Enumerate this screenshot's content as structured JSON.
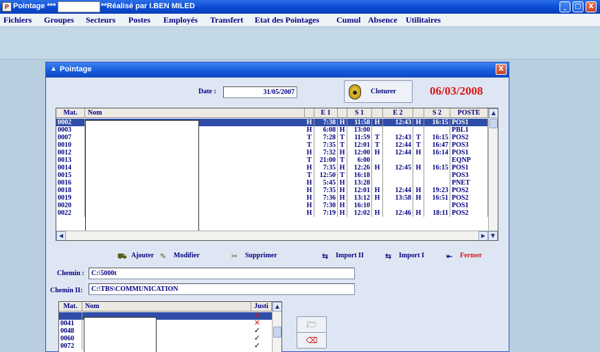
{
  "window": {
    "app_icon": "P",
    "title_left": "Pointage ***",
    "title_right": "**Réalisé par I.BEN MILED",
    "buttons": [
      "_",
      "□",
      "X"
    ]
  },
  "menu": [
    "Fichiers",
    "Groupes",
    "Secteurs",
    "Postes",
    "Employés",
    "Transfert",
    "Etat des Pointages",
    "Cumul",
    "Absence",
    "Utilitaires"
  ],
  "dialog": {
    "title": "Pointage",
    "title_icon": "triangle-icon",
    "close": "X",
    "date_label": "Date :",
    "date_value": "31/05/2007",
    "cloturer_label": "Cloturer",
    "current_date": "06/03/2008"
  },
  "grid": {
    "headers": [
      "Mat.",
      "Nom",
      "",
      "E 1",
      "",
      "S 1",
      "",
      "E 2",
      "",
      "S 2",
      "POSTE"
    ],
    "rows": [
      {
        "mat": "0002",
        "t1": "H",
        "e1": "7:38",
        "t2": "H",
        "s1": "11:58",
        "t3": "H",
        "e2": "12:43",
        "t4": "H",
        "s2": "16:15",
        "poste": "POS1",
        "selected": true
      },
      {
        "mat": "0003",
        "t1": "H",
        "e1": "6:08",
        "t2": "H",
        "s1": "13:00",
        "t3": "",
        "e2": "",
        "t4": "",
        "s2": "",
        "poste": "PBL1"
      },
      {
        "mat": "0007",
        "t1": "T",
        "e1": "7:28",
        "t2": "T",
        "s1": "11:59",
        "t3": "T",
        "e2": "12:43",
        "t4": "T",
        "s2": "16:15",
        "poste": "POS2"
      },
      {
        "mat": "0010",
        "t1": "T",
        "e1": "7:35",
        "t2": "T",
        "s1": "12:01",
        "t3": "T",
        "e2": "12:44",
        "t4": "T",
        "s2": "16:47",
        "poste": "POS3"
      },
      {
        "mat": "0012",
        "t1": "H",
        "e1": "7:32",
        "t2": "H",
        "s1": "12:00",
        "t3": "H",
        "e2": "12:44",
        "t4": "H",
        "s2": "16:14",
        "poste": "POS1"
      },
      {
        "mat": "0013",
        "t1": "T",
        "e1": "21:00",
        "t2": "T",
        "s1": "6:00",
        "t3": "",
        "e2": "",
        "t4": "",
        "s2": "",
        "poste": "EQNP"
      },
      {
        "mat": "0014",
        "t1": "H",
        "e1": "7:35",
        "t2": "H",
        "s1": "12:26",
        "t3": "H",
        "e2": "12:45",
        "t4": "H",
        "s2": "16:15",
        "poste": "POS1"
      },
      {
        "mat": "0015",
        "t1": "T",
        "e1": "12:50",
        "t2": "T",
        "s1": "16:18",
        "t3": "",
        "e2": "",
        "t4": "",
        "s2": "",
        "poste": "POS3"
      },
      {
        "mat": "0016",
        "t1": "H",
        "e1": "5:45",
        "t2": "H",
        "s1": "13:28",
        "t3": "",
        "e2": "",
        "t4": "",
        "s2": "",
        "poste": "PNET"
      },
      {
        "mat": "0018",
        "t1": "H",
        "e1": "7:35",
        "t2": "H",
        "s1": "12:01",
        "t3": "H",
        "e2": "12:44",
        "t4": "H",
        "s2": "19:23",
        "poste": "POS2"
      },
      {
        "mat": "0019",
        "t1": "H",
        "e1": "7:36",
        "t2": "H",
        "s1": "13:12",
        "t3": "H",
        "e2": "13:58",
        "t4": "H",
        "s2": "16:51",
        "poste": "POS2"
      },
      {
        "mat": "0020",
        "t1": "H",
        "e1": "7:30",
        "t2": "H",
        "s1": "16:10",
        "t3": "",
        "e2": "",
        "t4": "",
        "s2": "",
        "poste": "POS1"
      },
      {
        "mat": "0022",
        "t1": "H",
        "e1": "7:19",
        "t2": "H",
        "s1": "12:02",
        "t3": "H",
        "e2": "12:46",
        "t4": "H",
        "s2": "18:11",
        "poste": "POS2"
      }
    ]
  },
  "toolbar": {
    "ajouter": "Ajouter",
    "modifier": "Modifier",
    "supprimer": "Supprimer",
    "import2": "Import II",
    "import1": "Import I",
    "fermer": "Fermer"
  },
  "paths": {
    "chemin_label": "Chemin :",
    "chemin_value": "C:\\5000t",
    "chemin2_label": "Chemin II:",
    "chemin2_value": "C:\\TBS\\COMMUNICATION"
  },
  "grid2": {
    "headers": [
      "Mat.",
      "Nom",
      "Justi"
    ],
    "rows": [
      {
        "mat": "",
        "mark": "x"
      },
      {
        "mat": "0041",
        "mark": "x"
      },
      {
        "mat": "0048",
        "mark": "check"
      },
      {
        "mat": "0060",
        "mark": "check"
      },
      {
        "mat": "0072",
        "mark": "check"
      }
    ]
  },
  "colors": {
    "selected_row": "#2f4da8",
    "text": "#000080",
    "date_red": "#d81818",
    "cross_red": "#d01818"
  }
}
